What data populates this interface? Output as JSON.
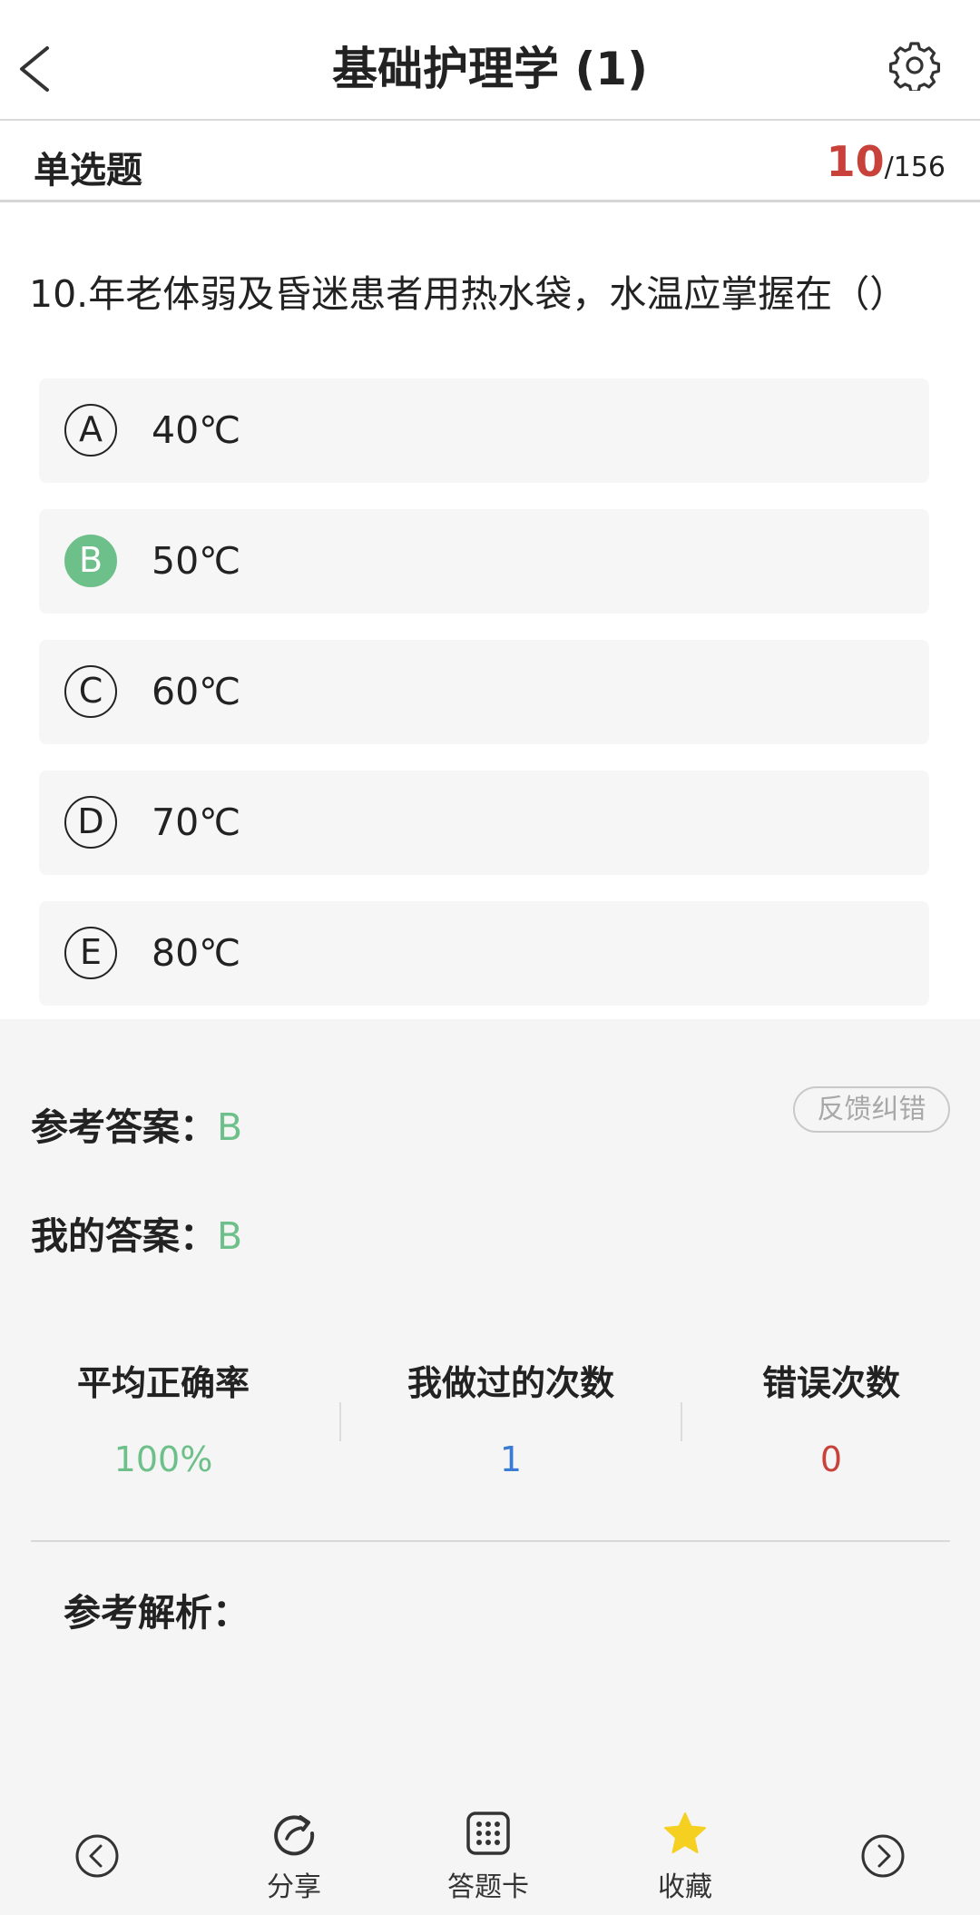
{
  "header": {
    "title": "基础护理学 (1)",
    "back_icon": "chevron-left-icon",
    "settings_icon": "gear-icon"
  },
  "subheader": {
    "question_type": "单选题",
    "current": "10",
    "total": "/156"
  },
  "question": {
    "text": "10.年老体弱及昏迷患者用热水袋，水温应掌握在（）"
  },
  "options": [
    {
      "letter": "A",
      "text": "40℃",
      "selected": false
    },
    {
      "letter": "B",
      "text": "50℃",
      "selected": true
    },
    {
      "letter": "C",
      "text": "60℃",
      "selected": false
    },
    {
      "letter": "D",
      "text": "70℃",
      "selected": false
    },
    {
      "letter": "E",
      "text": "80℃",
      "selected": false
    }
  ],
  "analysis": {
    "reference_label": "参考答案：",
    "reference_value": "B",
    "my_label": "我的答案：",
    "my_value": "B",
    "feedback_label": "反馈纠错",
    "stats": [
      {
        "label": "平均正确率",
        "value": "100%",
        "color": "#6ec08a"
      },
      {
        "label": "我做过的次数",
        "value": "1",
        "color": "#3a7bd5"
      },
      {
        "label": "错误次数",
        "value": "0",
        "color": "#c8413a"
      }
    ],
    "explanation_label": "参考解析："
  },
  "bottom_nav": {
    "prev_icon": "circle-chevron-left-icon",
    "share_label": "分享",
    "share_icon": "share-refresh-icon",
    "card_label": "答题卡",
    "card_icon": "grid-card-icon",
    "favorite_label": "收藏",
    "favorite_icon": "star-icon",
    "favorite_color": "#f5d020",
    "next_icon": "circle-chevron-right-icon"
  }
}
